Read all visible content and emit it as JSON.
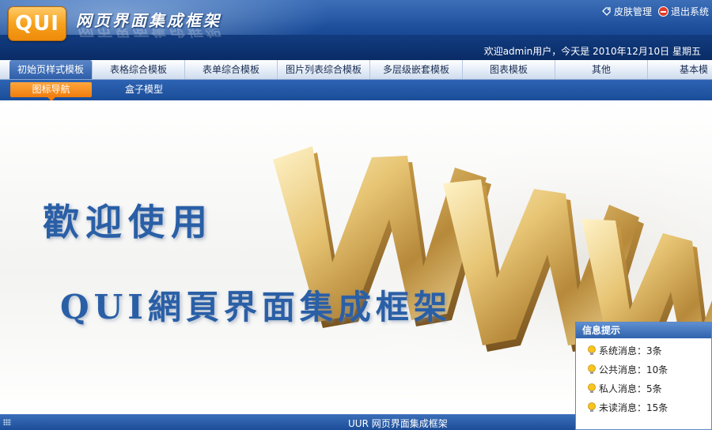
{
  "header": {
    "logo_text": "QUI",
    "app_title": "网页界面集成框架",
    "skin_label": "皮肤管理",
    "logout_label": "退出系统",
    "welcome": "欢迎admin用户，今天是 2010年12月10日 星期五"
  },
  "nav": {
    "items": [
      "初始页样式模板",
      "表格综合模板",
      "表单综合模板",
      "图片列表综合模板",
      "多层级嵌套模板",
      "图表模板",
      "其他",
      "基本模"
    ],
    "active_index": 0
  },
  "subnav": {
    "items": [
      "图标导航",
      "盒子模型"
    ],
    "active_index": 0
  },
  "banner": {
    "welcome_text": "歡迎使用",
    "product_text": "QUI網頁界面集成框架"
  },
  "info_panel": {
    "title": "信息提示",
    "items": [
      {
        "label": "系统消息：3条",
        "icon": "lightbulb-icon"
      },
      {
        "label": "公共消息：10条",
        "icon": "lightbulb-icon"
      },
      {
        "label": "私人消息：5条",
        "icon": "lightbulb-icon"
      },
      {
        "label": "未读消息：15条",
        "icon": "lightbulb-icon"
      }
    ]
  },
  "statusbar": {
    "copyright": "UUR 网页界面集成框架"
  },
  "colors": {
    "header_blue": "#1d4f9c",
    "accent_orange": "#f7a21c",
    "banner_text_blue": "#2a5fa6",
    "gold": "#d9b25a"
  }
}
